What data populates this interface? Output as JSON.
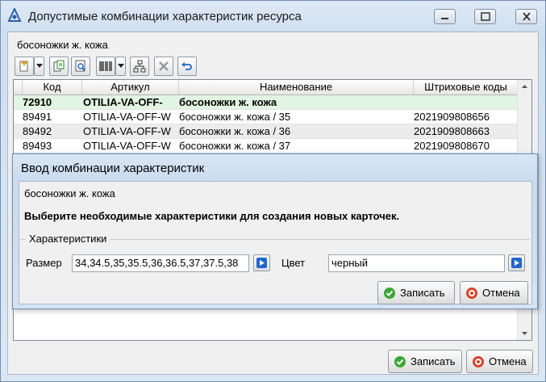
{
  "window": {
    "title": "Допустимые комбинации характеристик ресурса",
    "resource_label": "босоножки  ж.  кожа"
  },
  "grid": {
    "columns": [
      "Код",
      "Артикул",
      "Наименование",
      "Штриховые коды"
    ],
    "rows": [
      {
        "code": "72910",
        "article": "OTILIA-VA-OFF-",
        "name": "босоножки  ж.  кожа",
        "barcode": "",
        "bold": true
      },
      {
        "code": "89491",
        "article": "OTILIA-VA-OFF-W",
        "name": "босоножки  ж.  кожа   / 35",
        "barcode": "2021909808656",
        "bold": false
      },
      {
        "code": "89492",
        "article": "OTILIA-VA-OFF-W",
        "name": "босоножки  ж.  кожа   / 36",
        "barcode": "2021909808663",
        "bold": false
      },
      {
        "code": "89493",
        "article": "OTILIA-VA-OFF-W",
        "name": "босоножки  ж.  кожа   / 37",
        "barcode": "2021909808670",
        "bold": false
      }
    ]
  },
  "buttons": {
    "save": "Записать",
    "cancel": "Отмена"
  },
  "dialog": {
    "title": "Ввод комбинации характеристик",
    "resource_label": "босоножки  ж.  кожа",
    "message": "Выберите необходимые характеристики для создания новых карточек.",
    "group_title": "Характеристики",
    "size_label": "Размер",
    "size_value": "34,34.5,35,35.5,36,36.5,37,37.5,38",
    "color_label": "Цвет",
    "color_value": "черный",
    "save": "Записать",
    "cancel": "Отмена"
  },
  "colors": {
    "selected_row": "#e2f4e2",
    "alt_row": "#ececec",
    "save_icon": "#3aa635",
    "cancel_icon": "#d8432c",
    "select_btn_icon": "#2266cc"
  }
}
